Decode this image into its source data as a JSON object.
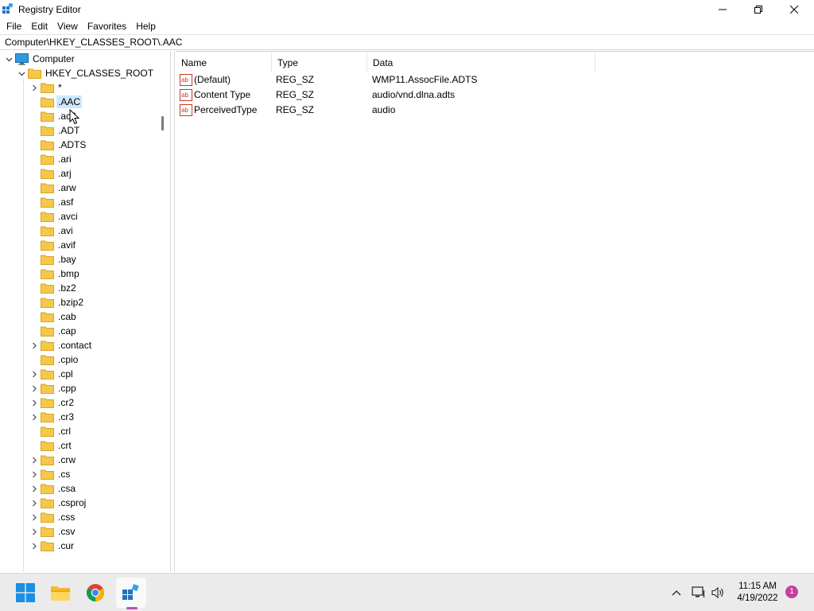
{
  "window": {
    "title": "Registry Editor",
    "menu": [
      "File",
      "Edit",
      "View",
      "Favorites",
      "Help"
    ],
    "address": "Computer\\HKEY_CLASSES_ROOT\\.AAC"
  },
  "tree": {
    "root": "Computer",
    "hive": "HKEY_CLASSES_ROOT",
    "keys": [
      {
        "label": "*",
        "expandable": true
      },
      {
        "label": ".AAC",
        "expandable": false,
        "selected": true
      },
      {
        "label": ".ac3",
        "expandable": false
      },
      {
        "label": ".ADT",
        "expandable": false
      },
      {
        "label": ".ADTS",
        "expandable": false
      },
      {
        "label": ".ari",
        "expandable": false
      },
      {
        "label": ".arj",
        "expandable": false
      },
      {
        "label": ".arw",
        "expandable": false
      },
      {
        "label": ".asf",
        "expandable": false
      },
      {
        "label": ".avci",
        "expandable": false
      },
      {
        "label": ".avi",
        "expandable": false
      },
      {
        "label": ".avif",
        "expandable": false
      },
      {
        "label": ".bay",
        "expandable": false
      },
      {
        "label": ".bmp",
        "expandable": false
      },
      {
        "label": ".bz2",
        "expandable": false
      },
      {
        "label": ".bzip2",
        "expandable": false
      },
      {
        "label": ".cab",
        "expandable": false
      },
      {
        "label": ".cap",
        "expandable": false
      },
      {
        "label": ".contact",
        "expandable": true
      },
      {
        "label": ".cpio",
        "expandable": false
      },
      {
        "label": ".cpl",
        "expandable": true
      },
      {
        "label": ".cpp",
        "expandable": true
      },
      {
        "label": ".cr2",
        "expandable": true
      },
      {
        "label": ".cr3",
        "expandable": true
      },
      {
        "label": ".crl",
        "expandable": false
      },
      {
        "label": ".crt",
        "expandable": false
      },
      {
        "label": ".crw",
        "expandable": true
      },
      {
        "label": ".cs",
        "expandable": true
      },
      {
        "label": ".csa",
        "expandable": true
      },
      {
        "label": ".csproj",
        "expandable": true
      },
      {
        "label": ".css",
        "expandable": true
      },
      {
        "label": ".csv",
        "expandable": true
      },
      {
        "label": ".cur",
        "expandable": true
      }
    ]
  },
  "list": {
    "columns": [
      "Name",
      "Type",
      "Data"
    ],
    "values": [
      {
        "name": "(Default)",
        "type": "REG_SZ",
        "data": "WMP11.AssocFile.ADTS"
      },
      {
        "name": "Content Type",
        "type": "REG_SZ",
        "data": "audio/vnd.dlna.adts"
      },
      {
        "name": "PerceivedType",
        "type": "REG_SZ",
        "data": "audio"
      }
    ]
  },
  "taskbar": {
    "apps": [
      "start-icon",
      "file-explorer-icon",
      "chrome-icon",
      "registry-editor-icon"
    ],
    "time": "11:15 AM",
    "date": "4/19/2022",
    "notification_count": "1"
  },
  "colors": {
    "selection": "#cce8ff",
    "folder": "#f4c84a",
    "accent": "#0067c0",
    "badge": "#c3409f"
  }
}
